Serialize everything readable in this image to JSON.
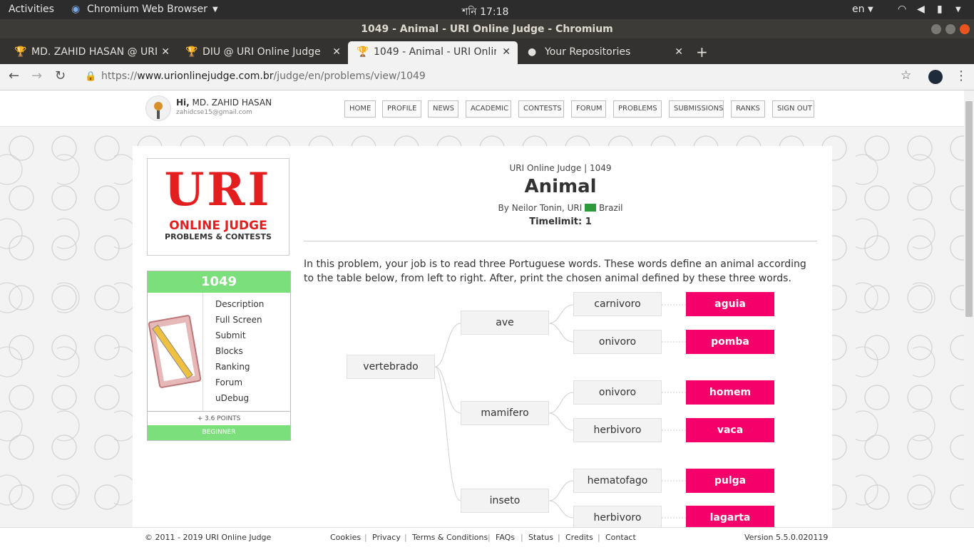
{
  "system": {
    "activities": "Activities",
    "app_name": "Chromium Web Browser",
    "clock": "শনি 17:18",
    "lang": "en"
  },
  "window": {
    "title": "1049 - Animal - URI Online Judge - Chromium"
  },
  "tabs": [
    {
      "label": "MD. ZAHID HASAN @ URI",
      "icon": "trophy-icon"
    },
    {
      "label": "DIU @ URI Online Judge",
      "icon": "trophy-icon"
    },
    {
      "label": "1049 - Animal - URI Online",
      "icon": "trophy-icon"
    },
    {
      "label": "Your Repositories",
      "icon": "github-icon"
    }
  ],
  "address": {
    "scheme": "https://",
    "host": "www.urionlinejudge.com.br",
    "path": "/judge/en/problems/view/1049"
  },
  "user": {
    "greeting": "Hi,",
    "name": "MD. ZAHID HASAN",
    "email": "zahidcse15@gmail.com"
  },
  "nav": [
    "HOME",
    "PROFILE",
    "NEWS",
    "ACADEMIC",
    "CONTESTS",
    "FORUM",
    "PROBLEMS",
    "SUBMISSIONS",
    "RANKS",
    "SIGN OUT"
  ],
  "logo": {
    "big": "URI",
    "line1": "ONLINE JUDGE",
    "line2": "PROBLEMS & CONTESTS"
  },
  "panel": {
    "id": "1049",
    "links": [
      "Description",
      "Full Screen",
      "Submit",
      "Blocks",
      "Ranking",
      "Forum",
      "uDebug"
    ],
    "points": "+ 3.6 POINTS",
    "level": "BEGINNER"
  },
  "problem": {
    "crumb": "URI Online Judge | 1049",
    "title": "Animal",
    "author_prefix": "By Neilor Tonin, URI",
    "author_country": "Brazil",
    "timelimit": "Timelimit: 1",
    "text": "In this problem, your job is to read three Portuguese words. These words define an animal according to the table below, from left to right. After, print the chosen animal defined by these three words."
  },
  "tree": {
    "root": "vertebrado",
    "level1": [
      "ave",
      "mamifero",
      "inseto"
    ],
    "level2": [
      "carnivoro",
      "onivoro",
      "onivoro",
      "herbivoro",
      "hematofago",
      "herbivoro"
    ],
    "leaves": [
      "aguia",
      "pomba",
      "homem",
      "vaca",
      "pulga",
      "lagarta"
    ],
    "leaf_color": "#f5006a"
  },
  "footer": {
    "copyright": "© 2011 - 2019 URI Online Judge",
    "links": [
      "Cookies",
      "Privacy",
      "Terms & Conditions",
      "FAQs",
      "Status",
      "Credits",
      "Contact"
    ],
    "version": "Version 5.5.0.020119"
  }
}
